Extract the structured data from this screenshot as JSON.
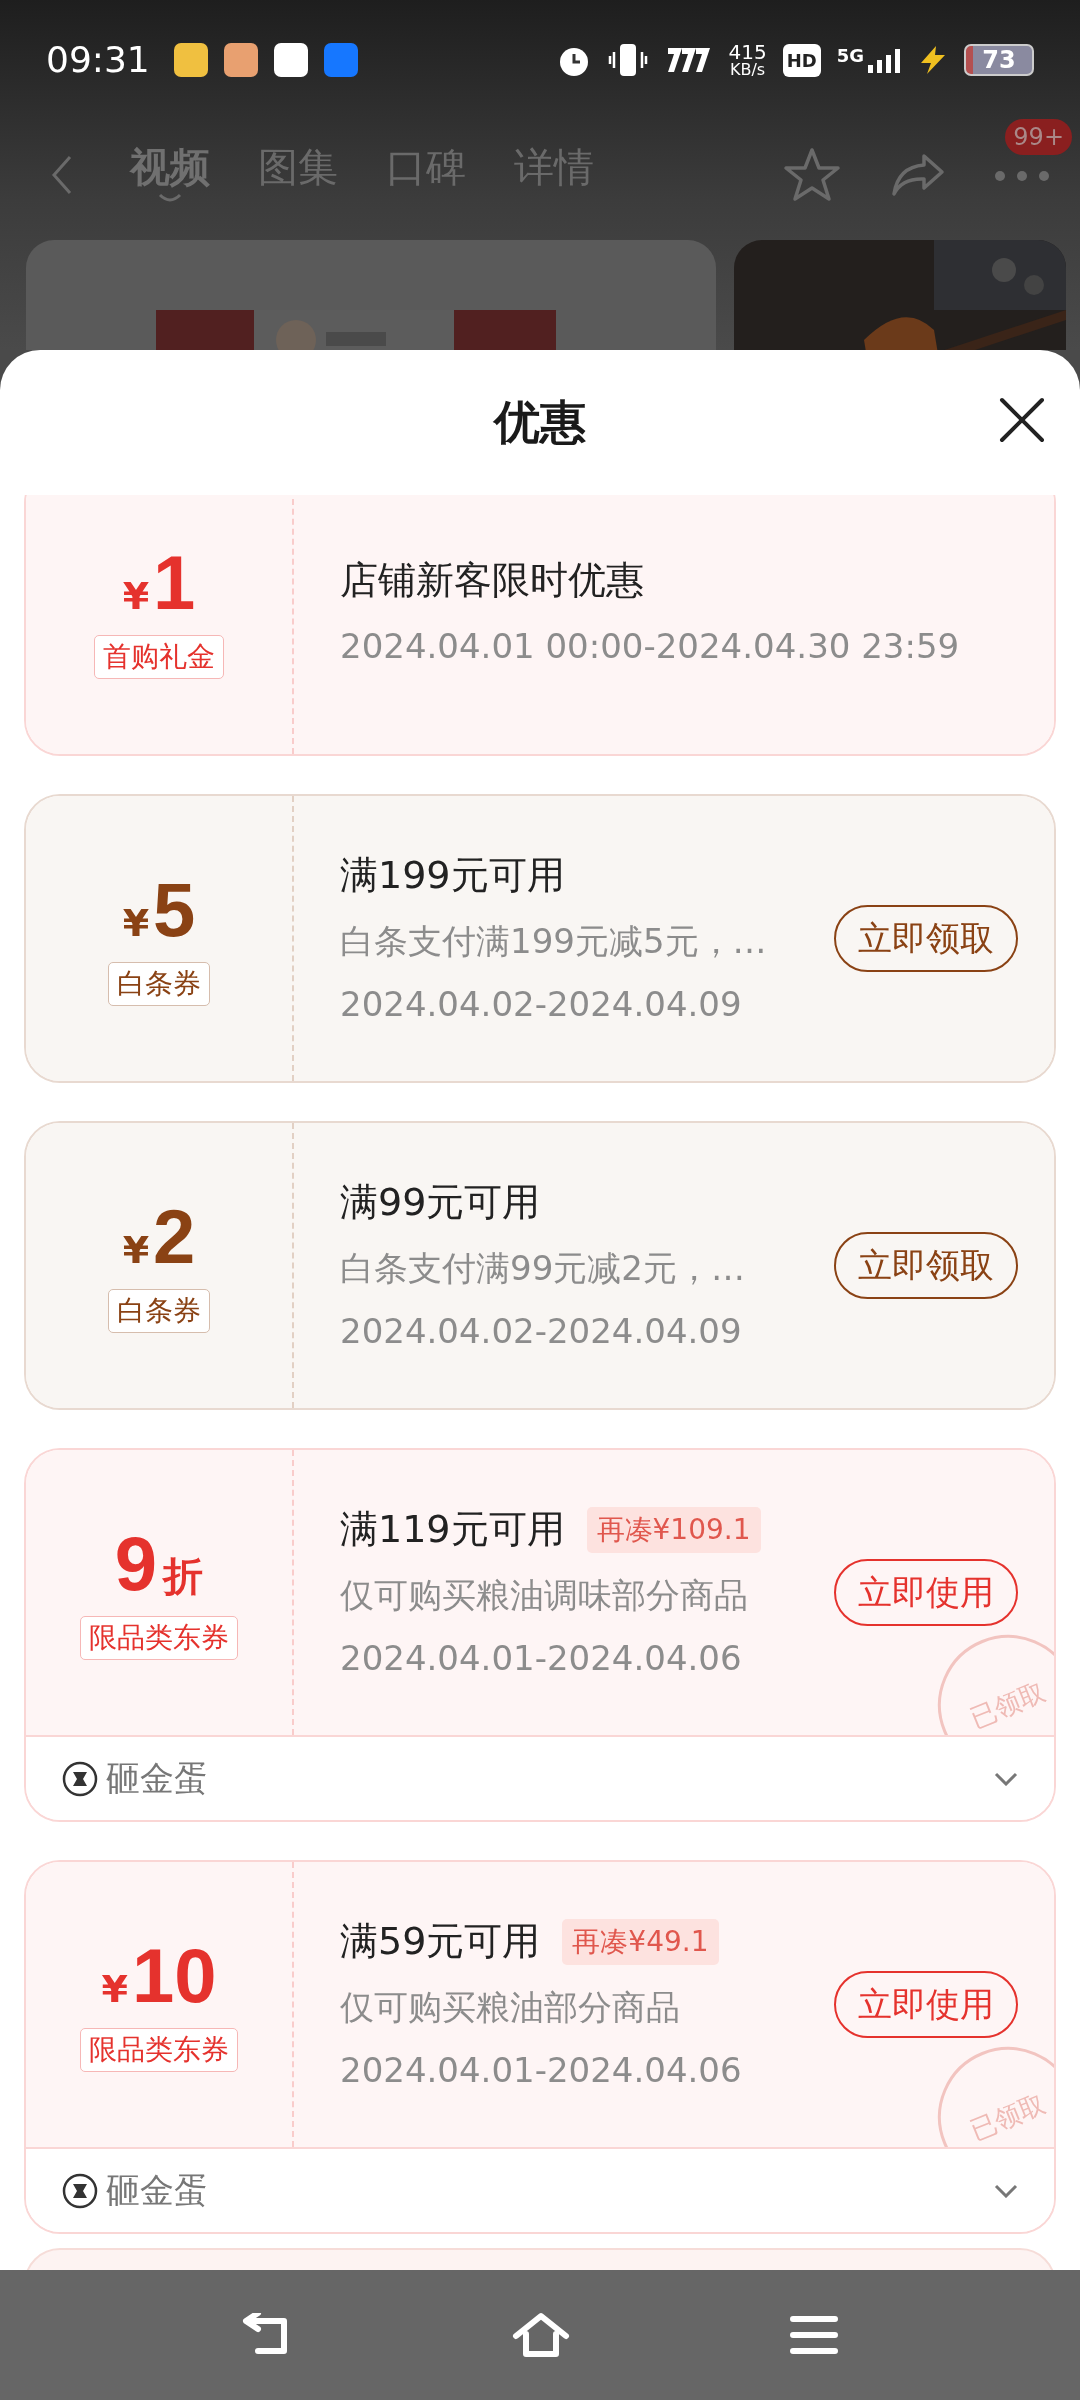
{
  "status_bar": {
    "time": "09:31",
    "net_speed": "415",
    "net_unit": "KB/s",
    "hd": "HD",
    "network": "5G",
    "battery": "73"
  },
  "header": {
    "tabs": [
      {
        "label": "视频",
        "selected": true
      },
      {
        "label": "图集",
        "selected": false
      },
      {
        "label": "口碑",
        "selected": false
      },
      {
        "label": "详情",
        "selected": false
      }
    ],
    "badge": "99+"
  },
  "sheet": {
    "title": "优惠",
    "coupons": [
      {
        "color": "#e5322d",
        "prefix": "¥",
        "value": "1",
        "badge": "首购礼金",
        "title": "店铺新客限时优惠",
        "date": "2024.04.01 00:00-2024.04.30 23:59"
      },
      {
        "color": "#8a4214",
        "prefix": "¥",
        "value": "5",
        "badge": "白条券",
        "title": "满199元可用",
        "description": "白条支付满199元减5元，…",
        "date": "2024.04.02-2024.04.09",
        "button": "立即领取"
      },
      {
        "color": "#8a4214",
        "prefix": "¥",
        "value": "2",
        "badge": "白条券",
        "title": "满99元可用",
        "description": "白条支付满99元减2元，…",
        "date": "2024.04.02-2024.04.09",
        "button": "立即领取"
      },
      {
        "color": "#e5322d",
        "value": "9",
        "suffix": "折",
        "badge": "限品类东券",
        "title": "满119元可用",
        "tag": "再凑¥109.1",
        "description": "仅可购买粮油调味部分商品",
        "date": "2024.04.01-2024.04.06",
        "button": "立即使用",
        "stamp": "已领取",
        "footer": {
          "label": "砸金蛋",
          "expanded": false
        }
      },
      {
        "color": "#e5322d",
        "prefix": "¥",
        "value": "10",
        "badge": "限品类东券",
        "title": "满59元可用",
        "tag": "再凑¥49.1",
        "description": "仅可购买粮油部分商品",
        "date": "2024.04.01-2024.04.06",
        "button": "立即使用",
        "stamp": "已领取",
        "footer": {
          "label": "砸金蛋",
          "expanded": false
        }
      }
    ]
  }
}
